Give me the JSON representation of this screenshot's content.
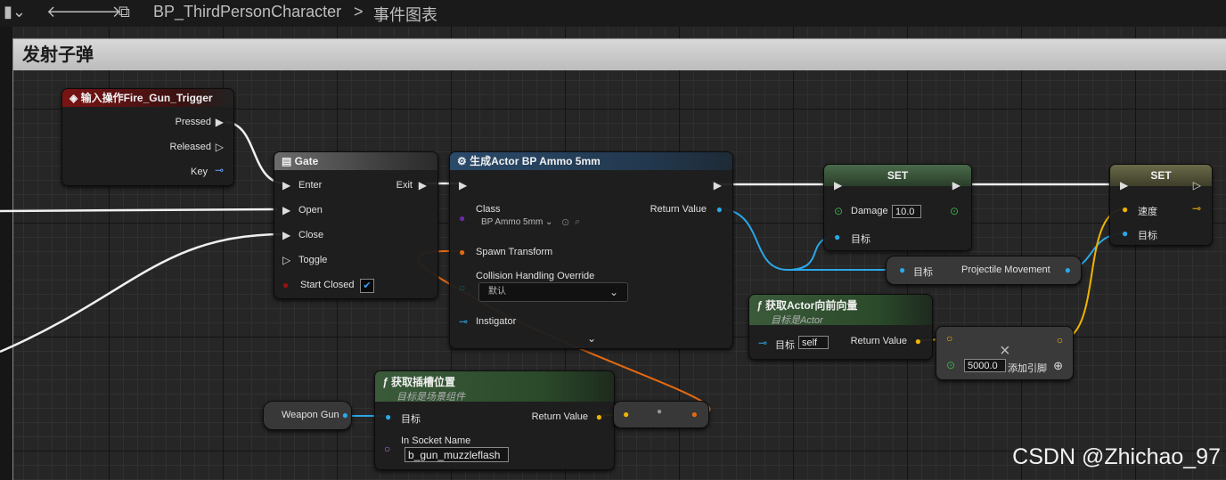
{
  "topbar": {
    "path_separator": ">",
    "blueprint": "BP_ThirdPersonCharacter",
    "graph": "事件图表"
  },
  "comment": {
    "title": "发射子弹"
  },
  "input_node": {
    "title": "输入操作Fire_Gun_Trigger",
    "pressed": "Pressed",
    "released": "Released",
    "key": "Key"
  },
  "gate": {
    "title": "Gate",
    "enter": "Enter",
    "exit": "Exit",
    "open": "Open",
    "close": "Close",
    "toggle": "Toggle",
    "start_closed": "Start Closed"
  },
  "spawn": {
    "title": "生成Actor BP Ammo 5mm",
    "class_label": "Class",
    "class_value": "BP Ammo 5mm",
    "return_value": "Return Value",
    "spawn_transform": "Spawn Transform",
    "collision_label": "Collision Handling Override",
    "collision_value": "默认",
    "instigator": "Instigator"
  },
  "set1": {
    "title": "SET",
    "damage": "Damage",
    "damage_value": "10.0",
    "target": "目标"
  },
  "set2": {
    "title": "SET",
    "speed": "速度",
    "target": "目标"
  },
  "projectile": {
    "target": "目标",
    "label": "Projectile Movement"
  },
  "forward": {
    "title": "获取Actor向前向量",
    "subtitle": "目标是Actor",
    "target": "目标",
    "target_value": "self",
    "return_value": "Return Value"
  },
  "multiply": {
    "value": "5000.0",
    "add_pin": "添加引脚",
    "op": "×"
  },
  "socket": {
    "title": "获取插槽位置",
    "subtitle": "目标是场景组件",
    "target": "目标",
    "return_value": "Return Value",
    "socket_label": "In Socket Name",
    "socket_value": "b_gun_muzzleflash"
  },
  "weapon_gun": {
    "label": "Weapon Gun"
  },
  "watermark": "CSDN @Zhichao_97"
}
